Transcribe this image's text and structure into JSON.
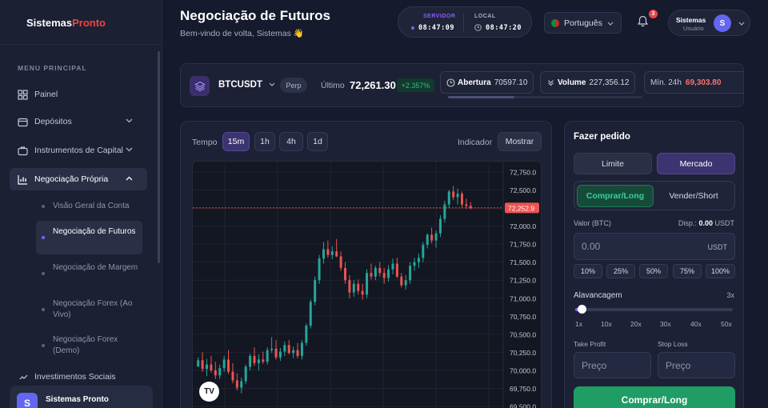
{
  "app": {
    "brand_main": "Sistemas",
    "brand_accent": "Pronto"
  },
  "sidebar": {
    "menu_title": "MENU PRINCIPAL",
    "items": [
      {
        "label": "Painel",
        "icon": "grid-icon"
      },
      {
        "label": "Depósitos",
        "icon": "wallet-icon"
      },
      {
        "label": "Instrumentos de Capital",
        "icon": "briefcase-icon"
      },
      {
        "label": "Negociação Própria",
        "icon": "chart-icon"
      },
      {
        "label": "Investimentos Sociais",
        "icon": "share-icon"
      }
    ],
    "subitems": [
      {
        "label": "Visão Geral da Conta"
      },
      {
        "label": "Negociação de Futuros"
      },
      {
        "label": "Negociação de Margem"
      },
      {
        "label": "Negociação Forex (Ao Vivo)"
      },
      {
        "label": "Negociação Forex (Demo)"
      }
    ],
    "user": {
      "initial": "S",
      "name": "Sistemas Pronto"
    }
  },
  "header": {
    "title": "Negociação de Futuros",
    "subtitle": "Bem-vindo de volta, Sistemas 👋",
    "server_label": "SERVIDOR",
    "server_time": "08:47:09",
    "local_label": "LOCAL",
    "local_time": "08:47:20",
    "language": "Português",
    "notif_count": "3",
    "user_name": "Sistemas",
    "user_role": "Usuário",
    "user_initial": "S"
  },
  "ticker": {
    "symbol": "BTCUSDT",
    "contract": "Perp",
    "last_label": "Último",
    "last_price": "72,261.30",
    "change": "+2.357%",
    "open_label": "Abertura",
    "open_value": "70597.10",
    "volume_label": "Volume",
    "volume_value": "227,356.12",
    "low_label": "Mín. 24h",
    "low_value": "69,303.80",
    "scroll_fraction": 0.34
  },
  "chart_controls": {
    "tempo_label": "Tempo",
    "timeframes": [
      "15m",
      "1h",
      "4h",
      "1d"
    ],
    "selected_timeframe": "15m",
    "indicator_label": "Indicador",
    "indicator_button": "Mostrar"
  },
  "chart_data": {
    "type": "candlestick",
    "ylim": [
      69500,
      72750
    ],
    "y_ticks": [
      "72,750.0",
      "72,500.0",
      "72,250.0",
      "72,000.0",
      "71,750.0",
      "71,500.0",
      "71,250.0",
      "71,000.0",
      "70,750.0",
      "70,500.0",
      "70,250.0",
      "70,000.0",
      "69,750.0",
      "69,500.0"
    ],
    "current_price_label": "72,252.9",
    "current_price": 72252.9,
    "up_color": "#26a69a",
    "down_color": "#ef5350",
    "candles": [
      [
        70050,
        70180,
        70050,
        70140
      ],
      [
        70140,
        70250,
        69980,
        70020
      ],
      [
        70020,
        70160,
        69920,
        70080
      ],
      [
        70080,
        70200,
        69970,
        70000
      ],
      [
        70000,
        70120,
        69880,
        69930
      ],
      [
        69930,
        70080,
        69880,
        70030
      ],
      [
        70030,
        70200,
        69980,
        70150
      ],
      [
        70150,
        70280,
        69950,
        69980
      ],
      [
        69980,
        70100,
        69820,
        69860
      ],
      [
        69860,
        69960,
        69720,
        69760
      ],
      [
        69760,
        69900,
        69680,
        69850
      ],
      [
        69850,
        70080,
        69810,
        70050
      ],
      [
        70050,
        70230,
        70000,
        70200
      ],
      [
        70200,
        70320,
        70060,
        70100
      ],
      [
        70100,
        70220,
        70000,
        70150
      ],
      [
        70150,
        70260,
        70090,
        70120
      ],
      [
        70120,
        70320,
        70080,
        70280
      ],
      [
        70280,
        70460,
        70240,
        70300
      ],
      [
        70300,
        70420,
        70150,
        70180
      ],
      [
        70180,
        70310,
        70130,
        70260
      ],
      [
        70260,
        70400,
        70200,
        70350
      ],
      [
        70350,
        70420,
        70220,
        70240
      ],
      [
        70240,
        70330,
        70170,
        70280
      ],
      [
        70280,
        70380,
        70170,
        70200
      ],
      [
        70200,
        70420,
        70150,
        70380
      ],
      [
        70380,
        70650,
        70340,
        70620
      ],
      [
        70620,
        70980,
        70580,
        70950
      ],
      [
        70950,
        71300,
        70900,
        71250
      ],
      [
        71250,
        71600,
        71200,
        71550
      ],
      [
        71550,
        71780,
        71480,
        71680
      ],
      [
        71680,
        71800,
        71560,
        71600
      ],
      [
        71600,
        71720,
        71540,
        71650
      ],
      [
        71650,
        71820,
        71570,
        71580
      ],
      [
        71580,
        71650,
        71380,
        71420
      ],
      [
        71420,
        71500,
        71200,
        71250
      ],
      [
        71250,
        71320,
        71000,
        71080
      ],
      [
        71080,
        71250,
        71020,
        71200
      ],
      [
        71200,
        71260,
        71050,
        71100
      ],
      [
        71100,
        71200,
        70980,
        71050
      ],
      [
        71050,
        71400,
        71000,
        71350
      ],
      [
        71350,
        71480,
        71260,
        71300
      ],
      [
        71300,
        71450,
        71250,
        71420
      ],
      [
        71420,
        71500,
        71300,
        71350
      ],
      [
        71350,
        71420,
        71200,
        71280
      ],
      [
        71280,
        71460,
        71230,
        71400
      ],
      [
        71400,
        71550,
        71330,
        71480
      ],
      [
        71480,
        71560,
        71280,
        71300
      ],
      [
        71300,
        71350,
        71150,
        71180
      ],
      [
        71180,
        71320,
        71120,
        71250
      ],
      [
        71250,
        71500,
        71200,
        71450
      ],
      [
        71450,
        71560,
        71380,
        71500
      ],
      [
        71500,
        71620,
        71420,
        71560
      ],
      [
        71560,
        71780,
        71500,
        71740
      ],
      [
        71740,
        71900,
        71690,
        71880
      ],
      [
        71880,
        71980,
        71760,
        71800
      ],
      [
        71800,
        71940,
        71700,
        71900
      ],
      [
        71900,
        72150,
        71850,
        72100
      ],
      [
        72100,
        72350,
        72050,
        72300
      ],
      [
        72300,
        72500,
        72250,
        72480
      ],
      [
        72480,
        72560,
        72360,
        72400
      ],
      [
        72400,
        72520,
        72300,
        72450
      ],
      [
        72450,
        72480,
        72250,
        72300
      ],
      [
        72300,
        72380,
        72240,
        72280
      ],
      [
        72280,
        72330,
        72230,
        72253
      ]
    ]
  },
  "order": {
    "title": "Fazer pedido",
    "type_limit": "Limite",
    "type_market": "Mercado",
    "side_buy": "Comprar/Long",
    "side_sell": "Vender/Short",
    "value_label": "Valor (BTC)",
    "available_label": "Disp.:",
    "available_value": "0.00",
    "available_unit": "USDT",
    "amount_placeholder": "0.00",
    "amount_unit": "USDT",
    "percent_buttons": [
      "10%",
      "25%",
      "50%",
      "75%",
      "100%"
    ],
    "leverage_label": "Alavancagem",
    "leverage_value": "3x",
    "leverage_min": 1,
    "leverage_max": 50,
    "leverage_current": 3,
    "leverage_ticks": [
      "1x",
      "10x",
      "20x",
      "30x",
      "40x",
      "50x"
    ],
    "take_profit_label": "Take Profit",
    "stop_loss_label": "Stop Loss",
    "price_placeholder": "Preço",
    "submit_label": "Comprar/Long",
    "colors": {
      "accent": "#8b5cf6",
      "buy": "#1f9d65",
      "sell": "#ef4444"
    }
  }
}
